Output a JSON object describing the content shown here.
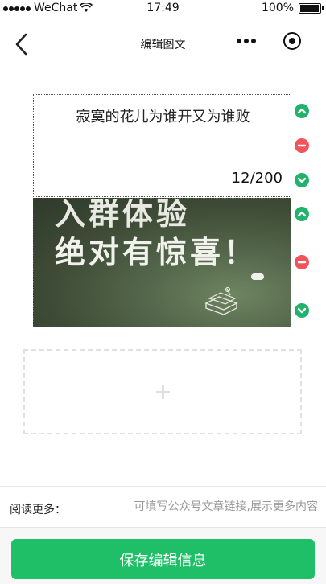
{
  "status_bar": {
    "carrier": "WeChat",
    "time": "17:49",
    "battery": "100%"
  },
  "nav": {
    "title": "编辑图文"
  },
  "blocks": [
    {
      "type": "text",
      "text": "寂寞的花儿为谁开又为谁败",
      "counter": "12/200"
    },
    {
      "type": "image",
      "image_text_line1": "入群体验",
      "image_text_line2": "绝对有惊喜！"
    }
  ],
  "read_more": {
    "label": "阅读更多：",
    "placeholder": "可填写公众号文章链接,展示更多内容",
    "value": ""
  },
  "save_button": {
    "label": "保存编辑信息"
  },
  "colors": {
    "accent_green": "#1fbf68",
    "delete_red": "#f2545b"
  },
  "icons": [
    "signal-dots-icon",
    "wifi-icon",
    "battery-icon",
    "back-arrow-icon",
    "more-icon",
    "target-icon",
    "move-up-icon",
    "delete-icon",
    "move-down-icon",
    "add-icon"
  ]
}
